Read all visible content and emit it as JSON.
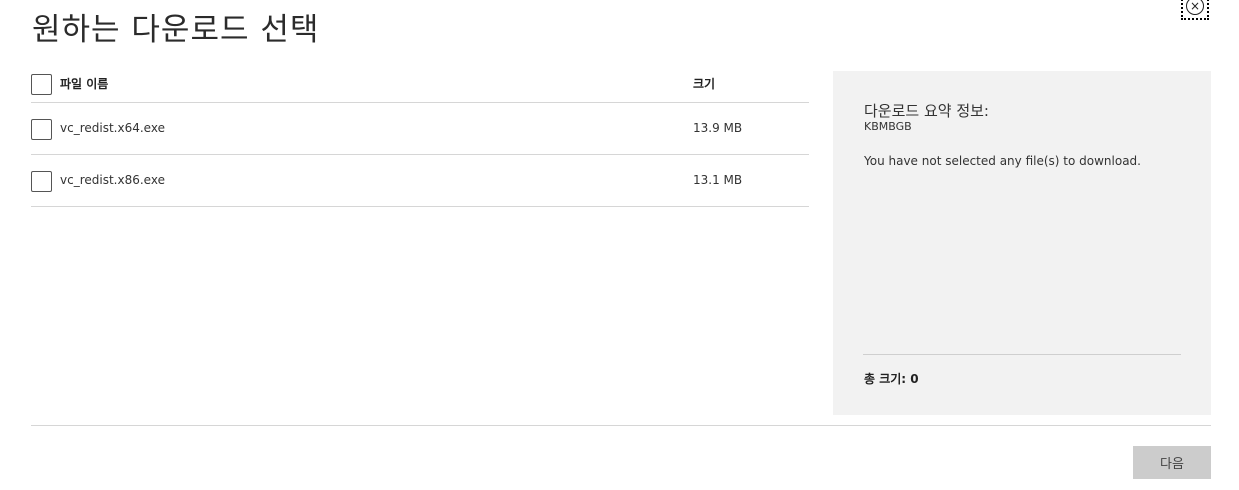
{
  "dialog": {
    "title": "원하는 다운로드 선택",
    "close_symbol": "×"
  },
  "table": {
    "columns": {
      "name": "파일 이름",
      "size": "크기"
    },
    "rows": [
      {
        "name": "vc_redist.x64.exe",
        "size": "13.9 MB",
        "checked": false
      },
      {
        "name": "vc_redist.x86.exe",
        "size": "13.1 MB",
        "checked": false
      }
    ]
  },
  "summary": {
    "title": "다운로드 요약 정보:",
    "subtitle": "KBMBGB",
    "message": "You have not selected any file(s) to download.",
    "total": "총 크기: 0"
  },
  "footer": {
    "next_label": "다음"
  },
  "colors": {
    "panel_background": "#f2f2f2",
    "divider": "#d6d6d6",
    "button_disabled": "#cccccc"
  },
  "icons": {
    "close": "close-icon"
  }
}
